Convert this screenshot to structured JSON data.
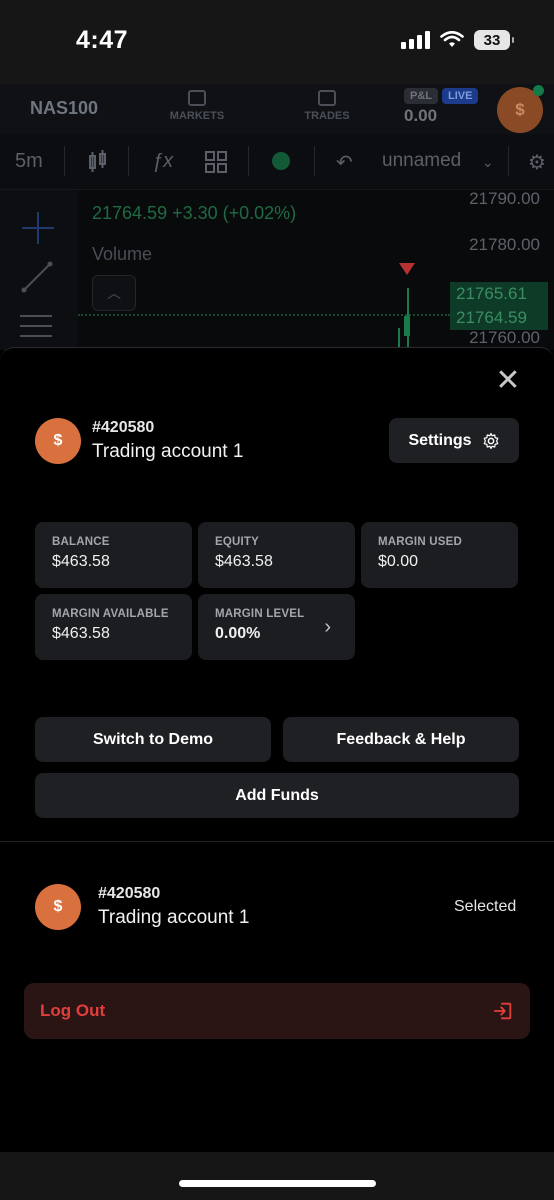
{
  "status_bar": {
    "time": "4:47",
    "battery": "33"
  },
  "header": {
    "symbol": "NAS100",
    "nav": [
      {
        "label": "MARKETS"
      },
      {
        "label": "TRADES"
      }
    ],
    "pl_label": "P&L",
    "live_label": "LIVE",
    "pl_value": "0.00",
    "avatar_glyph": "$"
  },
  "chart_toolbar": {
    "timeframe": "5m",
    "layout_name": "unnamed"
  },
  "chart": {
    "quote": "21764.59 +3.30 (+0.02%)",
    "volume_label": "Volume",
    "prices": [
      "21790.00",
      "21780.00",
      "21765.61",
      "21764.59",
      "21760.00"
    ]
  },
  "account": {
    "number": "#420580",
    "name": "Trading account 1",
    "avatar_glyph": "$",
    "settings_label": "Settings"
  },
  "stats": [
    {
      "label": "BALANCE",
      "value": "$463.58"
    },
    {
      "label": "EQUITY",
      "value": "$463.58"
    },
    {
      "label": "MARGIN USED",
      "value": "$0.00"
    },
    {
      "label": "MARGIN AVAILABLE",
      "value": "$463.58"
    },
    {
      "label": "MARGIN LEVEL",
      "value": "0.00%"
    }
  ],
  "actions": {
    "switch_demo": "Switch to Demo",
    "feedback": "Feedback & Help",
    "add_funds": "Add Funds"
  },
  "account_list": [
    {
      "number": "#420580",
      "name": "Trading account 1",
      "status": "Selected",
      "avatar_glyph": "$"
    }
  ],
  "logout_label": "Log Out",
  "colors": {
    "accent": "#d9713e",
    "danger": "#e0403c",
    "positive": "#3a8e62"
  }
}
